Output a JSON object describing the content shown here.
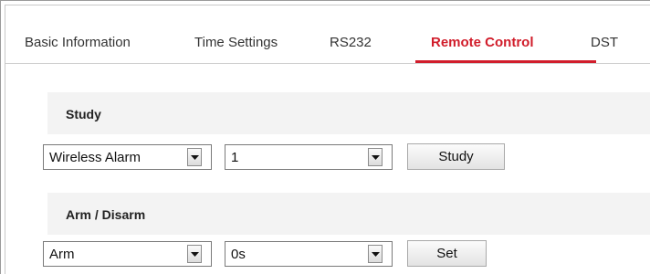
{
  "tabs": [
    {
      "label": "Basic Information",
      "active": false
    },
    {
      "label": "Time Settings",
      "active": false
    },
    {
      "label": "RS232",
      "active": false
    },
    {
      "label": "Remote Control",
      "active": true
    },
    {
      "label": "DST",
      "active": false
    }
  ],
  "colors": {
    "active_tab": "#d11d2b",
    "section_bg": "#f3f3f3"
  },
  "study": {
    "title": "Study",
    "type_select": {
      "value": "Wireless Alarm"
    },
    "number_select": {
      "value": "1"
    },
    "button_label": "Study"
  },
  "arm_disarm": {
    "title": "Arm / Disarm",
    "mode_select": {
      "value": "Arm"
    },
    "delay_select": {
      "value": "0s"
    },
    "button_label": "Set"
  },
  "icons": {
    "dropdown": "chevron-down-icon"
  }
}
